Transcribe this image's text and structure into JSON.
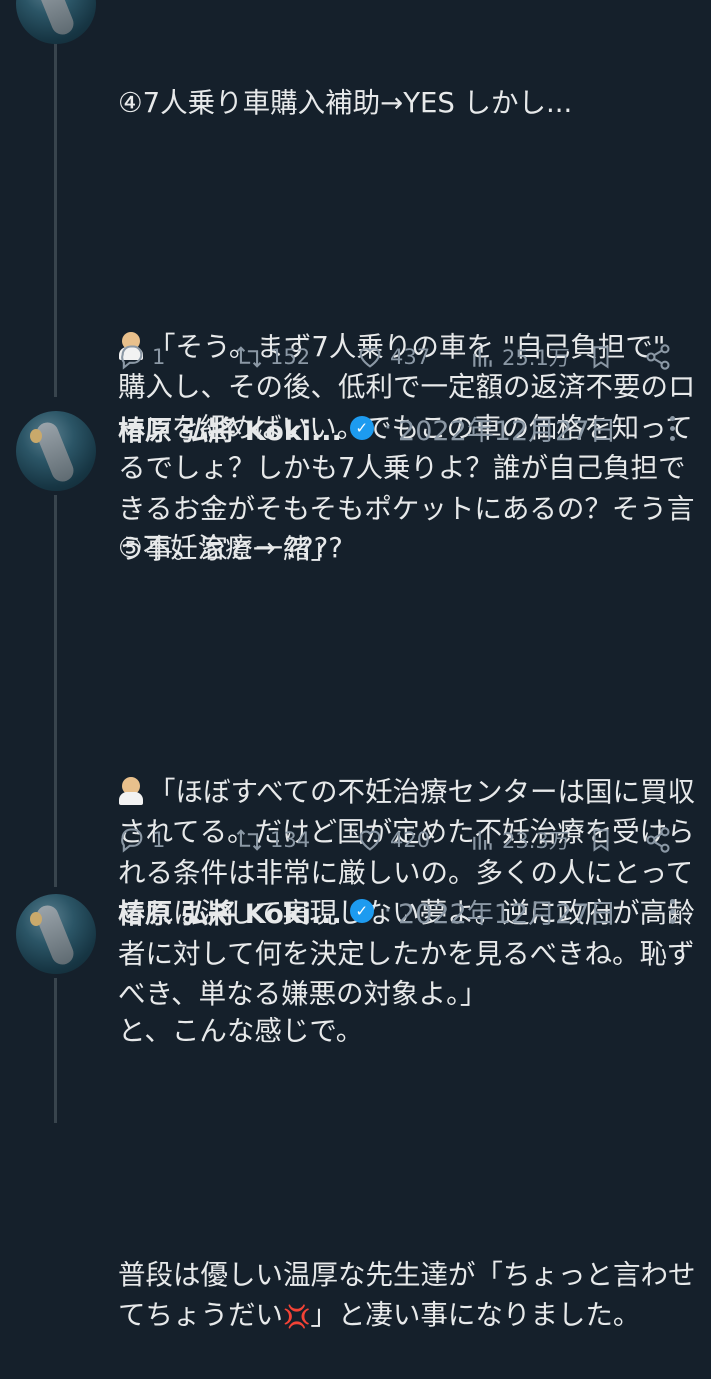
{
  "tweets": [
    {
      "body_line1": "④7人乗り車購入補助→YES しかし...",
      "body_line2": "「そう。まず7人乗りの車を \"自己負担で\" 購入し、その後、低利で一定額の返済不要のローンを組めばいい。でもこの車の価格を知ってるでしょ？しかも7人乗りよ？誰が自己負担できるお金がそもそもポケットにあるの？そう言う事。家と一緒」",
      "stats": {
        "replies": "1",
        "retweets": "152",
        "likes": "437",
        "views": "25.1万"
      }
    },
    {
      "author": "椿原 弘將 Koki...",
      "date": "2022年12月27日",
      "body_line1": "⑤不妊治療→ ????",
      "body_line2": "「ほぼすべての不妊治療センターは国に買収されてる。だけど国が定めた不妊治療を受けられる条件は非常に厳しいの。多くの人にとってこれは決して実現しない夢よ。逆に政府が高齢者に対して何を決定したかを見るべきね。恥ずべき、単なる嫌悪の対象よ。」",
      "stats": {
        "replies": "1",
        "retweets": "134",
        "likes": "420",
        "views": "23.3万"
      }
    },
    {
      "author": "椿原 弘將 Koki...",
      "date": "2022年12月27日",
      "body_line1": "と、こんな感じで。",
      "body_line2a": "普段は優しい温厚な先生達が「ちょっと言わせてちょうだい",
      "body_line2b": "」と凄い事になりました。"
    }
  ],
  "separator": "·",
  "icons": [
    "reply-icon",
    "retweet-icon",
    "like-icon",
    "views-icon",
    "bookmark-icon",
    "share-icon",
    "more-icon",
    "verified-icon",
    "doctor-emoji",
    "anger-emoji"
  ],
  "colors": {
    "background": "#15202b",
    "text": "#e7e9ea",
    "muted": "#8b98a5",
    "verified": "#1d9bf0",
    "thread_line": "#38444d"
  }
}
